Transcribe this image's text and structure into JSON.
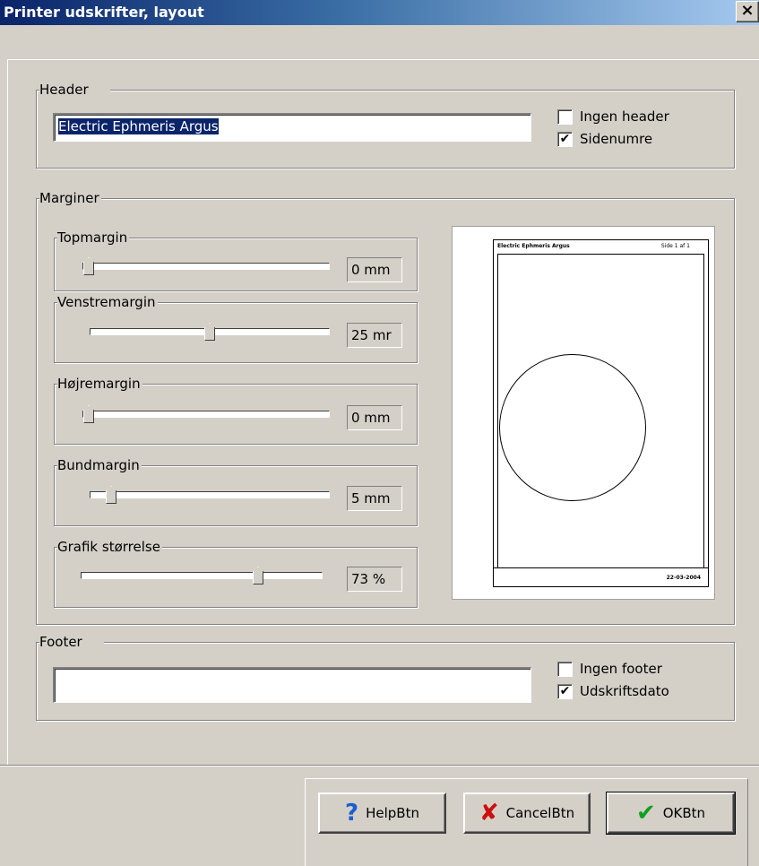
{
  "window": {
    "title": "Printer udskrifter, layout",
    "close_glyph": "×"
  },
  "header": {
    "label": "Header",
    "value": "Electric Ephmeris Argus",
    "checkboxes": [
      {
        "label": "Ingen header",
        "checked": false
      },
      {
        "label": "Sidenumre",
        "checked": true
      }
    ]
  },
  "margins": {
    "label": "Marginer",
    "sliders": [
      {
        "label": "Topmargin",
        "value_text": "0 mm",
        "position": 0.0
      },
      {
        "label": "Venstremargin",
        "value_text": "25 mr",
        "position": 0.5
      },
      {
        "label": "Højremargin",
        "value_text": "0 mm",
        "position": 0.0
      },
      {
        "label": "Bundmargin",
        "value_text": "5 mm",
        "position": 0.08
      },
      {
        "label": "Grafik størrelse",
        "value_text": "73 %",
        "position": 0.73
      }
    ]
  },
  "preview": {
    "header_text": "Electric Ephmeris Argus",
    "header_page": "Side 1 af 1",
    "footer_text": "22-03-2004"
  },
  "footer": {
    "label": "Footer",
    "value": "",
    "checkboxes": [
      {
        "label": "Ingen footer",
        "checked": false
      },
      {
        "label": "Udskriftsdato",
        "checked": true
      }
    ]
  },
  "buttons": {
    "help": {
      "label": "HelpBtn",
      "icon": "question-icon"
    },
    "cancel": {
      "label": "CancelBtn",
      "icon": "x-icon"
    },
    "ok": {
      "label": "OKBtn",
      "icon": "check-icon"
    }
  },
  "colors": {
    "titlebar": "#0a246a",
    "help_icon": "#1a5fd0",
    "cancel_icon": "#cc1010",
    "ok_icon": "#10a020"
  }
}
